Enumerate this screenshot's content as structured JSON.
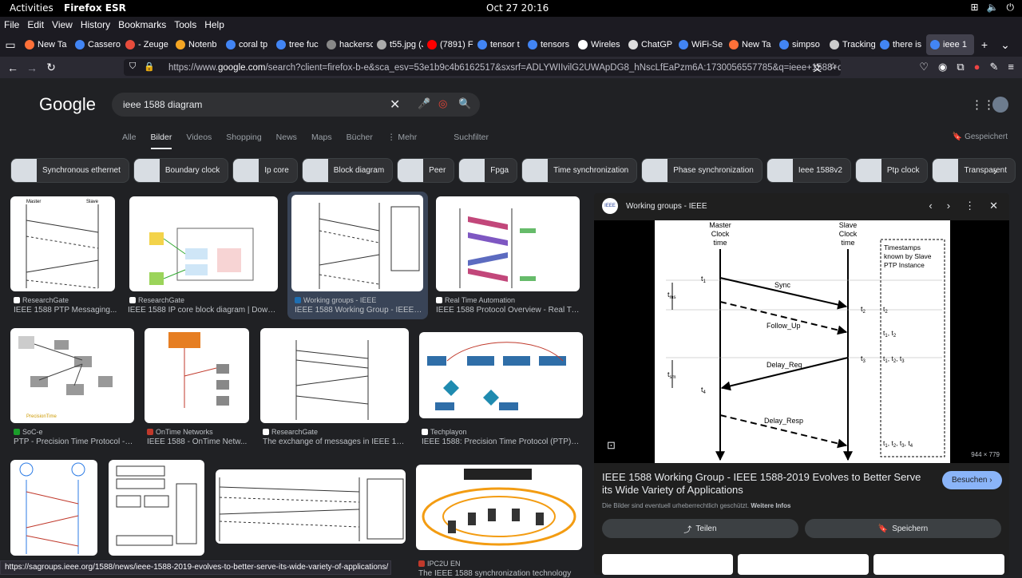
{
  "system": {
    "activities": "Activities",
    "app": "Firefox ESR",
    "clock": "Oct 27  20:16"
  },
  "menu": [
    "File",
    "Edit",
    "View",
    "History",
    "Bookmarks",
    "Tools",
    "Help"
  ],
  "tabs": [
    {
      "label": "New Ta",
      "color": "#ff7139"
    },
    {
      "label": "Cassero",
      "color": "#4285f4"
    },
    {
      "label": "- Zeuge",
      "color": "#e74c3c"
    },
    {
      "label": "Notenb",
      "color": "#f5a623"
    },
    {
      "label": "coral tp",
      "color": "#4285f4"
    },
    {
      "label": "tree fuc",
      "color": "#4285f4"
    },
    {
      "label": "hackerscan",
      "color": "#888888"
    },
    {
      "label": "t55.jpg (JP",
      "color": "#aaaaaa"
    },
    {
      "label": "(7891) F",
      "color": "#ff0000"
    },
    {
      "label": "tensor t",
      "color": "#4285f4"
    },
    {
      "label": "tensors",
      "color": "#4285f4"
    },
    {
      "label": "Wireles",
      "color": "#ffffff"
    },
    {
      "label": "ChatGP",
      "color": "#dddddd"
    },
    {
      "label": "WiFi-Se",
      "color": "#4285f4"
    },
    {
      "label": "New Ta",
      "color": "#ff7139"
    },
    {
      "label": "simpso",
      "color": "#4285f4"
    },
    {
      "label": "Tracking",
      "color": "#cccccc"
    },
    {
      "label": "there is",
      "color": "#4285f4"
    },
    {
      "label": "ieee 1",
      "color": "#4285f4",
      "active": true
    }
  ],
  "url": {
    "prefix": "https://www.",
    "host": "google.com",
    "path": "/search?client=firefox-b-e&sca_esv=53e1b9c4b6162517&sxsrf=ADLYWIIvilG2UWApDG8_hNscLfEaPzm6A:1730056557785&q=ieee+1588+diagram&u"
  },
  "search": {
    "logo": "Google",
    "query": "ieee 1588 diagram"
  },
  "filters": [
    "Alle",
    "Bilder",
    "Videos",
    "Shopping",
    "News",
    "Maps",
    "Bücher",
    "⋮ Mehr",
    "Suchfilter"
  ],
  "saved": "Gespeichert",
  "chips": [
    "Synchronous ethernet",
    "Boundary clock",
    "Ip core",
    "Block diagram",
    "Peer",
    "Fpga",
    "Time synchronization",
    "Phase synchronization",
    "Ieee 1588v2",
    "Ptp clock",
    "Transparent"
  ],
  "results": [
    {
      "source": "ResearchGate",
      "title": "IEEE 1588 PTP Messaging..."
    },
    {
      "source": "ResearchGate",
      "title": "IEEE 1588 IP core block diagram | Downl..."
    },
    {
      "source": "Working groups - IEEE",
      "title": "IEEE 1588 Working Group - IEEE ..."
    },
    {
      "source": "Real Time Automation",
      "title": "IEEE 1588 Protocol Overview - Real Ti..."
    },
    {
      "source": "SoC-e",
      "title": "PTP - Precision Time Protocol - ..."
    },
    {
      "source": "OnTime Networks",
      "title": "IEEE 1588 - OnTime Netw..."
    },
    {
      "source": "ResearchGate",
      "title": "The exchange of messages in IEEE 158..."
    },
    {
      "source": "Techplayon",
      "title": "IEEE 1588: Precision Time Protocol (PTP) f..."
    },
    {
      "source": "IPC2U EN",
      "title": "The IEEE 1588 synchronization technology"
    }
  ],
  "panel": {
    "source": "Working groups - IEEE",
    "dims": "944 × 779",
    "title": "IEEE 1588 Working Group - IEEE 1588-2019 Evolves to Better Serve its Wide Variety of Applications",
    "visit": "Besuchen",
    "copyright": "Die Bilder sind eventuell urheberrechtlich geschützt.",
    "more_info": "Weitere Infos",
    "share": "Teilen",
    "save": "Speichern",
    "diagram": {
      "master": [
        "Master",
        "Clock",
        "time"
      ],
      "slave": [
        "Slave",
        "Clock",
        "time"
      ],
      "box": [
        "Timestamps",
        "known  by Slave",
        "PTP Instance"
      ],
      "msgs": [
        "Sync",
        "Follow_Up",
        "Delay_Req",
        "Delay_Resp"
      ],
      "ts": [
        "t2",
        "t1, t2",
        "t1, t2, t3",
        "t1, t2, t3, t4"
      ]
    }
  },
  "status_url": "https://sagroups.ieee.org/1588/news/ieee-1588-2019-evolves-to-better-serve-its-wide-variety-of-applications/"
}
